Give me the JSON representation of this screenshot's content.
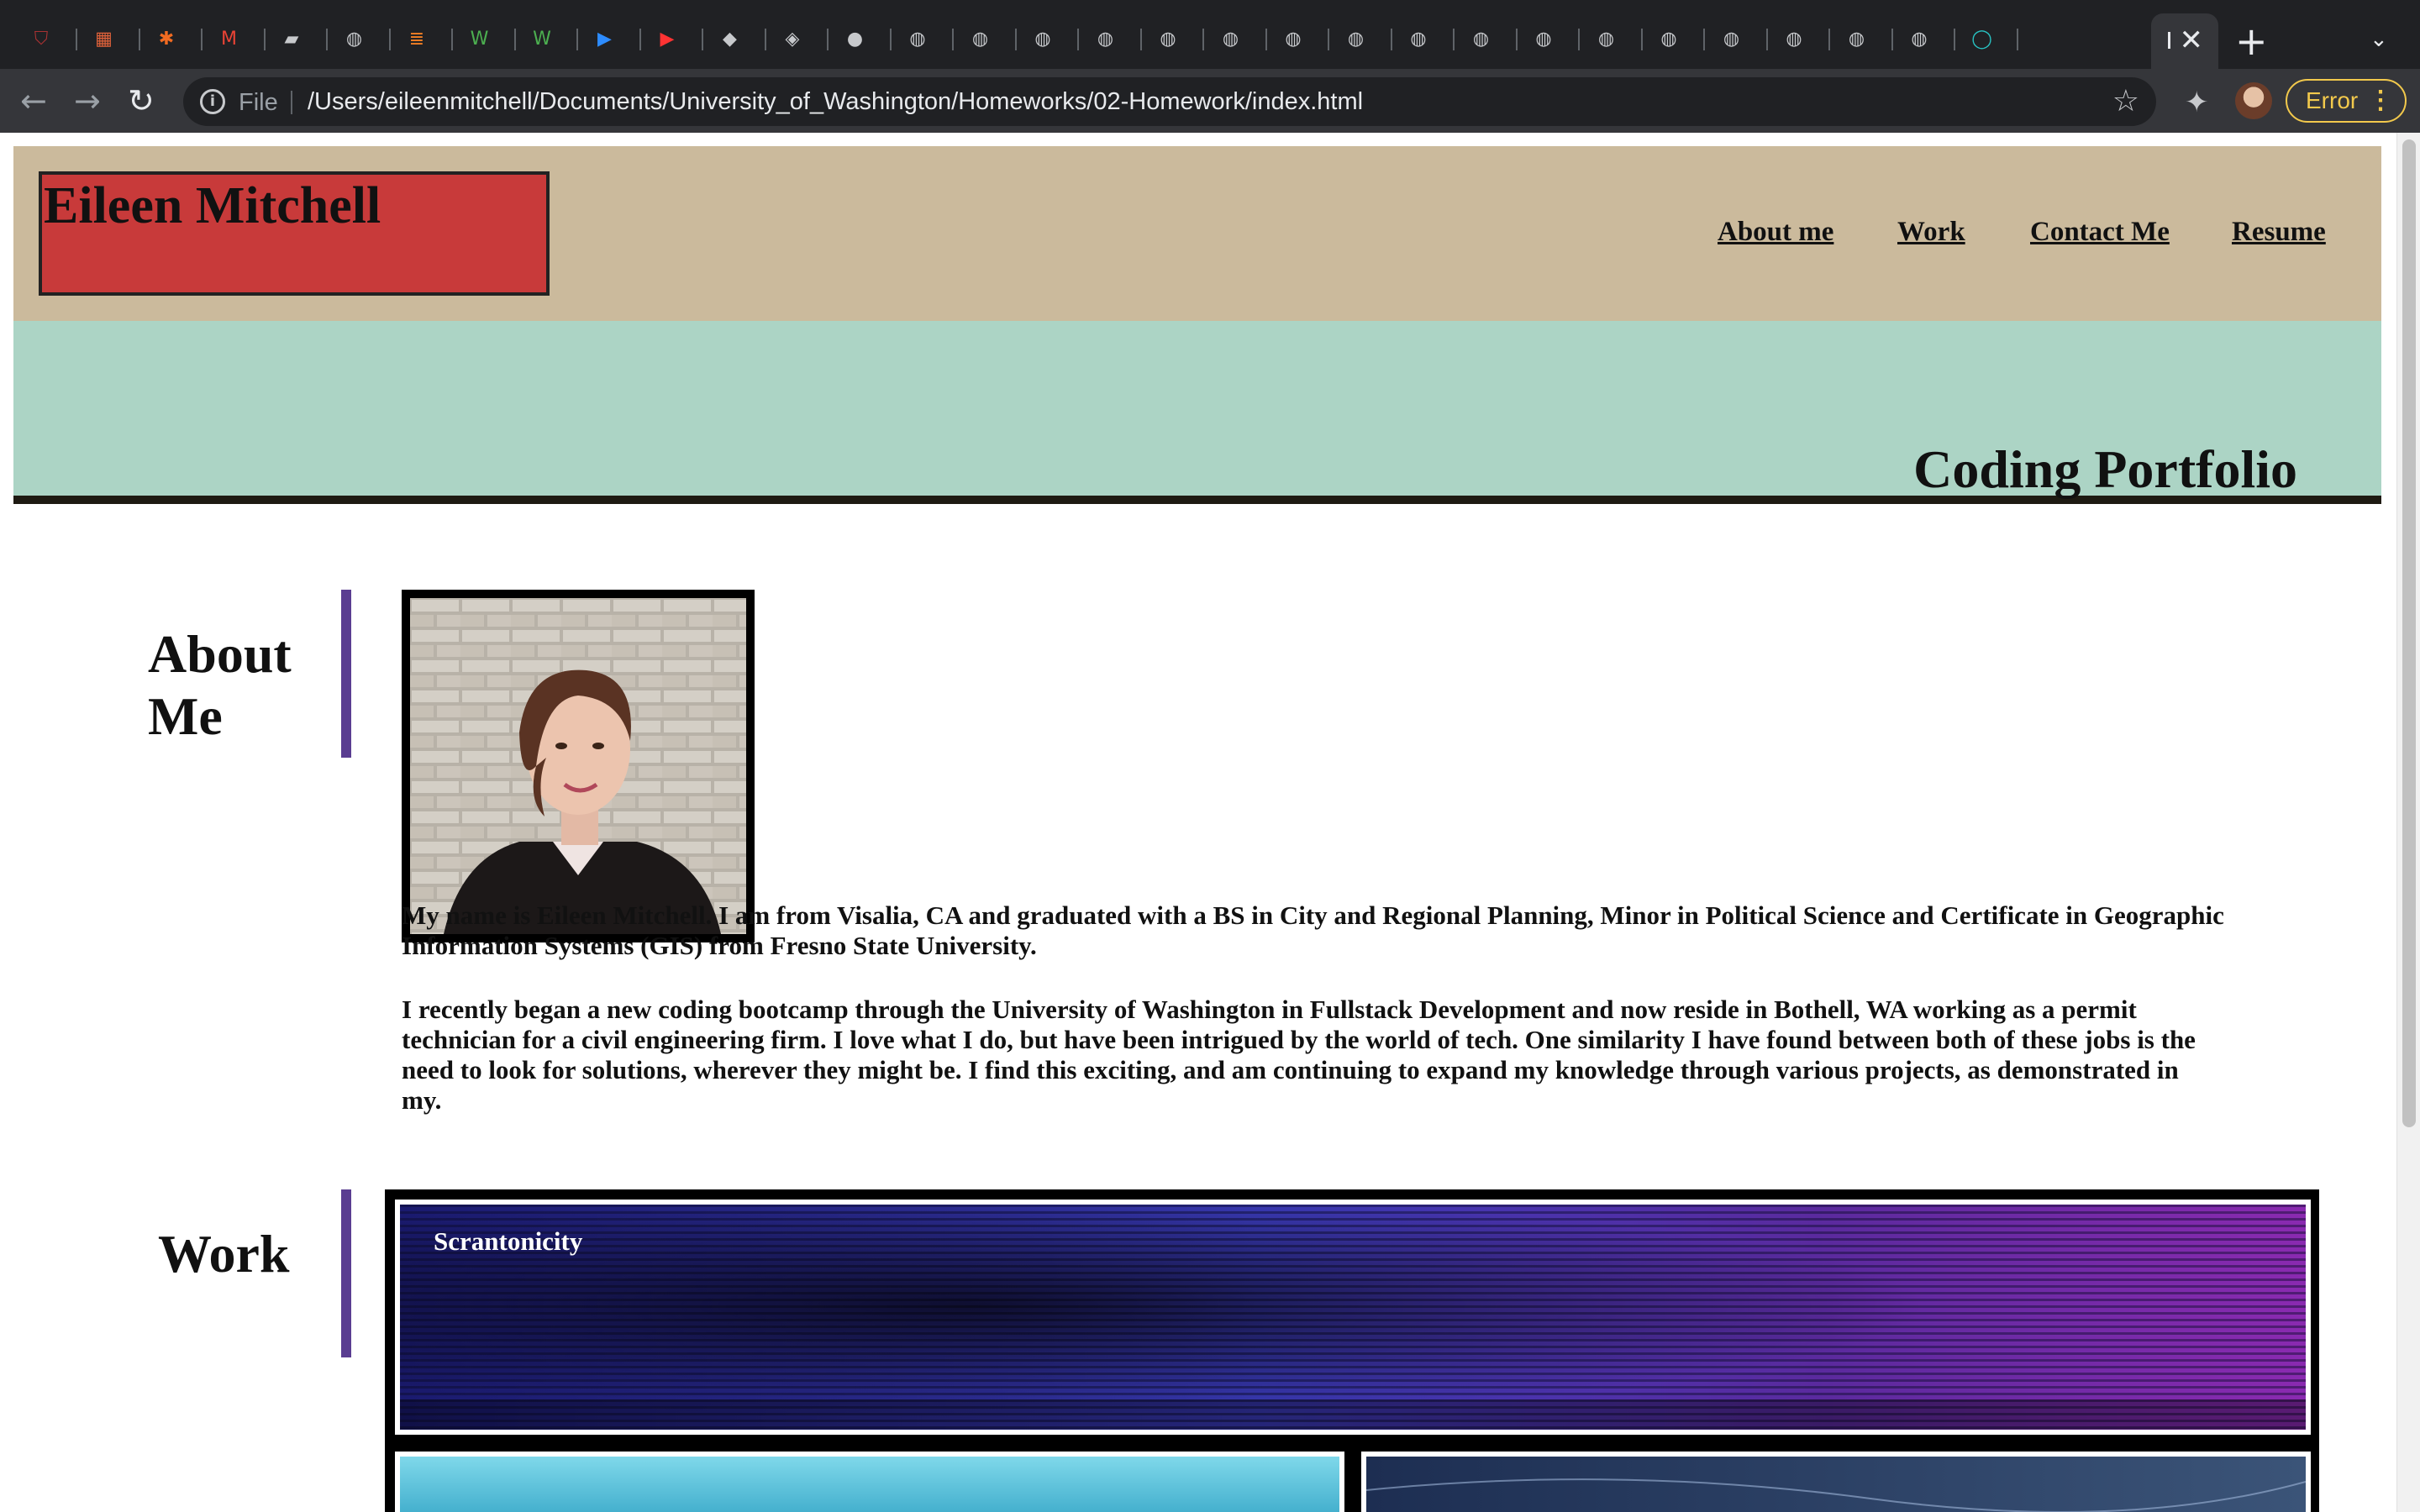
{
  "browser": {
    "tabs": [
      {
        "icon": "shield-icon"
      },
      {
        "icon": "app-icon"
      },
      {
        "icon": "asterisk-icon"
      },
      {
        "icon": "gmail-icon"
      },
      {
        "icon": "notebook-icon"
      },
      {
        "icon": "globe-icon"
      },
      {
        "icon": "stackoverflow-icon"
      },
      {
        "icon": "w-icon"
      },
      {
        "icon": "w-icon"
      },
      {
        "icon": "zoom-icon"
      },
      {
        "icon": "youtube-icon"
      },
      {
        "icon": "bird-icon"
      },
      {
        "icon": "box-icon"
      },
      {
        "icon": "github-icon"
      },
      {
        "icon": "globe-icon"
      },
      {
        "icon": "globe-icon"
      },
      {
        "icon": "globe-icon"
      },
      {
        "icon": "globe-icon"
      },
      {
        "icon": "globe-icon"
      },
      {
        "icon": "globe-icon"
      },
      {
        "icon": "globe-icon"
      },
      {
        "icon": "globe-icon"
      },
      {
        "icon": "globe-icon"
      },
      {
        "icon": "globe-icon"
      },
      {
        "icon": "globe-icon"
      },
      {
        "icon": "globe-icon"
      },
      {
        "icon": "globe-icon"
      },
      {
        "icon": "globe-icon"
      },
      {
        "icon": "globe-icon"
      },
      {
        "icon": "globe-icon"
      },
      {
        "icon": "globe-icon"
      },
      {
        "icon": "circle-icon"
      }
    ],
    "address": {
      "scheme": "File",
      "url": "/Users/eileenmitchell/Documents/University_of_Washington/Homeworks/02-Homework/index.html"
    },
    "profile_status": "Error",
    "colors": {
      "chrome_dark": "#202124",
      "toolbar": "#35363a",
      "error": "#f2c94c"
    }
  },
  "site": {
    "logo": "Eileen Mitchell",
    "nav": [
      "About me",
      "Work",
      "Contact Me",
      "Resume"
    ],
    "hero_title": "Coding Portfolio",
    "colors": {
      "header": "#cbba9c",
      "logo_box": "#c83a3a",
      "hero": "#acd4c5",
      "section_bar": "#5a3d91"
    }
  },
  "about": {
    "heading": "About Me",
    "paragraph1": "My name is Eileen Mitchell. I am from Visalia, CA and graduated with a BS in City and Regional Planning, Minor in Political Science and Certificate in Geographic Information Systems (GIS) from Fresno State University.",
    "paragraph2": "I recently began a new coding bootcamp through the University of Washington in Fullstack Development and now reside in Bothell, WA working as a permit technician for a civil engineering firm. I love what I do, but have been intrigued by the world of tech. One similarity I have found between both of these jobs is the need to look for solutions, wherever they might be. I find this exciting, and am continuing to expand my knowledge through various projects, as demonstrated in my."
  },
  "work": {
    "heading": "Work",
    "projects": [
      {
        "label": "Scrantonicity"
      }
    ]
  }
}
